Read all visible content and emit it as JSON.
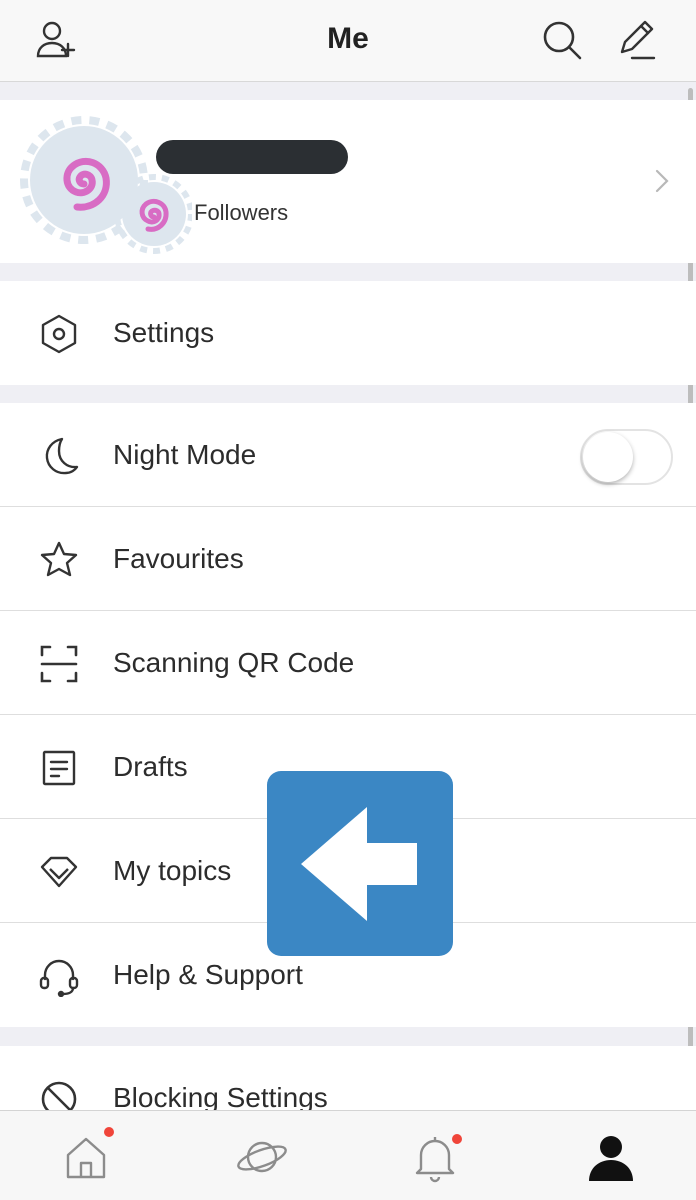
{
  "header": {
    "title": "Me",
    "left_icon": "add-friend-icon",
    "right_icons": [
      "search-icon",
      "compose-icon"
    ]
  },
  "profile": {
    "followers_label": "Followers",
    "avatar_icon": "spiral-avatar-icon"
  },
  "menu": {
    "settings": {
      "label": "Settings",
      "icon": "hexagon-gear-icon"
    },
    "night_mode": {
      "label": "Night Mode",
      "icon": "moon-icon",
      "enabled": false
    },
    "favourites": {
      "label": "Favourites",
      "icon": "star-icon"
    },
    "scan_qr": {
      "label": "Scanning QR Code",
      "icon": "scan-frame-icon"
    },
    "drafts": {
      "label": "Drafts",
      "icon": "document-icon"
    },
    "my_topics": {
      "label": "My topics",
      "icon": "diamond-icon"
    },
    "help": {
      "label": "Help & Support",
      "icon": "headset-icon"
    },
    "blocking": {
      "label": "Blocking Settings",
      "icon": "block-icon"
    }
  },
  "tabbar": {
    "items": [
      {
        "name": "home",
        "icon": "home-icon",
        "badge": true
      },
      {
        "name": "explore",
        "icon": "planet-icon",
        "badge": false
      },
      {
        "name": "notifications",
        "icon": "bell-icon",
        "badge": true
      },
      {
        "name": "me",
        "icon": "person-icon",
        "active": true
      }
    ]
  },
  "colors": {
    "overlay_arrow_bg": "#3b87c4",
    "badge": "#f0453a",
    "avatar_spiral": "#d86cc4",
    "avatar_bg": "#dde6ee"
  }
}
